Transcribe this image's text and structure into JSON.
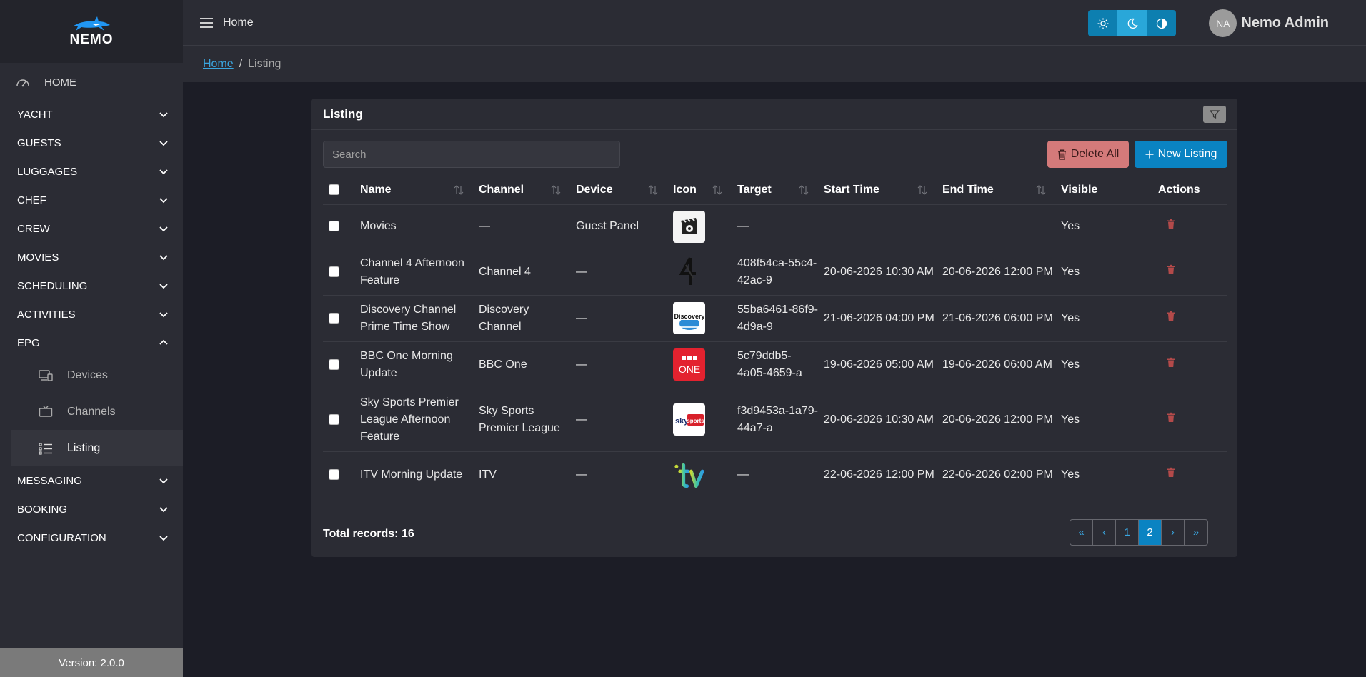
{
  "sidebar": {
    "logo_text": "NEMO",
    "items": [
      {
        "label": "HOME",
        "icon": "dashboard-icon"
      },
      {
        "label": "YACHT"
      },
      {
        "label": "GUESTS"
      },
      {
        "label": "LUGGAGES"
      },
      {
        "label": "CHEF"
      },
      {
        "label": "CREW"
      },
      {
        "label": "MOVIES"
      },
      {
        "label": "SCHEDULING"
      },
      {
        "label": "ACTIVITIES"
      },
      {
        "label": "EPG",
        "expanded": true
      },
      {
        "label": "MESSAGING"
      },
      {
        "label": "BOOKING"
      },
      {
        "label": "CONFIGURATION"
      }
    ],
    "epg_sub": [
      {
        "label": "Devices",
        "icon": "devices-icon"
      },
      {
        "label": "Channels",
        "icon": "tv-icon"
      },
      {
        "label": "Listing",
        "icon": "list-icon",
        "active": true
      }
    ],
    "version": "Version: 2.0.0"
  },
  "header": {
    "title": "Home",
    "theme_buttons": [
      "sun-icon",
      "moon-icon",
      "contrast-icon"
    ],
    "active_theme": "moon-icon",
    "user_initials": "NA",
    "user_name": "Nemo Admin"
  },
  "breadcrumb": {
    "home": "Home",
    "separator": "/",
    "current": "Listing"
  },
  "card": {
    "title": "Listing",
    "search_placeholder": "Search",
    "delete_all_label": "Delete All",
    "new_listing_label": "New Listing",
    "columns": [
      "Name",
      "Channel",
      "Device",
      "Icon",
      "Target",
      "Start Time",
      "End Time",
      "Visible",
      "Actions"
    ],
    "rows": [
      {
        "name": "Movies",
        "channel": "—",
        "device": "Guest Panel",
        "icon": "movies-clapper-icon",
        "target": "—",
        "start": "",
        "end": "",
        "visible": "Yes"
      },
      {
        "name": "Channel 4 Afternoon Feature",
        "channel": "Channel 4",
        "device": "—",
        "icon": "channel4-logo-icon",
        "target": "408f54ca-55c4-42ac-9",
        "start": "20-06-2026 10:30 AM",
        "end": "20-06-2026 12:00 PM",
        "visible": "Yes"
      },
      {
        "name": "Discovery Channel Prime Time Show",
        "channel": "Discovery Channel",
        "device": "—",
        "icon": "discovery-logo-icon",
        "target": "55ba6461-86f9-4d9a-9",
        "start": "21-06-2026 04:00 PM",
        "end": "21-06-2026 06:00 PM",
        "visible": "Yes"
      },
      {
        "name": "BBC One Morning Update",
        "channel": "BBC One",
        "device": "—",
        "icon": "bbc-one-logo-icon",
        "target": "5c79ddb5-4a05-4659-a",
        "start": "19-06-2026 05:00 AM",
        "end": "19-06-2026 06:00 AM",
        "visible": "Yes"
      },
      {
        "name": "Sky Sports Premier League Afternoon Feature",
        "channel": "Sky Sports Premier League",
        "device": "—",
        "icon": "sky-sports-logo-icon",
        "target": "f3d9453a-1a79-44a7-a",
        "start": "20-06-2026 10:30 AM",
        "end": "20-06-2026 12:00 PM",
        "visible": "Yes"
      },
      {
        "name": "ITV Morning Update",
        "channel": "ITV",
        "device": "—",
        "icon": "itv-logo-icon",
        "target": "—",
        "start": "22-06-2026 12:00 PM",
        "end": "22-06-2026 02:00 PM",
        "visible": "Yes"
      }
    ],
    "total_records": "Total records: 16",
    "pagination": {
      "first": "«",
      "prev": "‹",
      "pages": [
        "1",
        "2"
      ],
      "current": "2",
      "next": "›",
      "last": "»"
    }
  },
  "colors": {
    "accent": "#0a83c2",
    "danger": "#d47a7a",
    "bg": "#1c1d26",
    "panel": "#2b2c34"
  }
}
